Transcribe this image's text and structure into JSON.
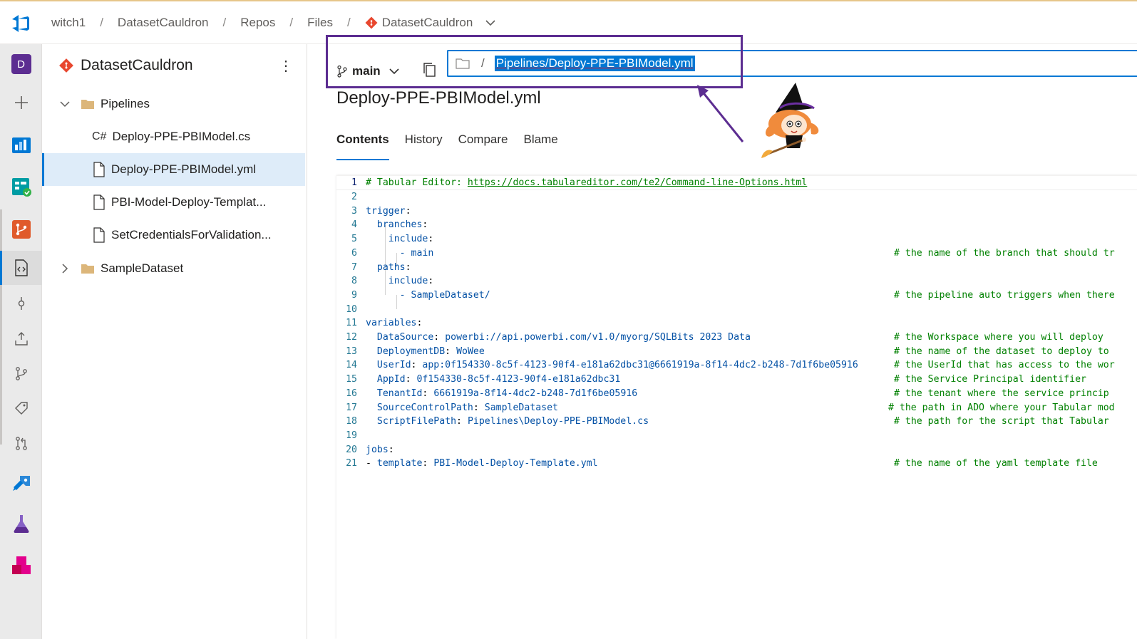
{
  "breadcrumb": {
    "org": "witch1",
    "project": "DatasetCauldron",
    "section": "Repos",
    "page": "Files",
    "repo": "DatasetCauldron"
  },
  "rail": {
    "avatar_letter": "D"
  },
  "tree": {
    "repo_name": "DatasetCauldron",
    "folder_pipelines": "Pipelines",
    "file_cs_tag": "C#",
    "file_cs": "Deploy-PPE-PBIModel.cs",
    "file_yml": "Deploy-PPE-PBIModel.yml",
    "file_template": "PBI-Model-Deploy-Templat...",
    "file_credentials": "SetCredentialsForValidation...",
    "folder_dataset": "SampleDataset"
  },
  "toolbar": {
    "branch": "main",
    "path_sep": "/",
    "path": "Pipelines/Deploy-PPE-PBIModel.yml"
  },
  "file": {
    "title": "Deploy-PPE-PBIModel.yml"
  },
  "tabs": [
    "Contents",
    "History",
    "Compare",
    "Blame"
  ],
  "code": {
    "l1_comment": "# Tabular Editor: ",
    "l1_link": "https://docs.tabulareditor.com/te2/Command-line-Options.html",
    "l3": "trigger",
    "l4": "branches",
    "l5": "include",
    "l6_val": "- main",
    "l6_comment": "# the name of the branch that should tr",
    "l7": "paths",
    "l8": "include",
    "l9_val": "- SampleDataset/",
    "l9_comment": "# the pipeline auto triggers when there",
    "l11": "variables",
    "l12_key": "DataSource",
    "l12_val": "powerbi://api.powerbi.com/v1.0/myorg/SQLBits 2023 Data",
    "l12_comment": "# the Workspace where you will deploy",
    "l13_key": "DeploymentDB",
    "l13_val": "WoWee",
    "l13_comment": "# the name of the dataset to deploy to",
    "l14_key": "UserId",
    "l14_val": "app:0f154330-8c5f-4123-90f4-e181a62dbc31@6661919a-8f14-4dc2-b248-7d1f6be05916",
    "l14_comment": "# the UserId that has access to the wor",
    "l15_key": "AppId",
    "l15_val": "0f154330-8c5f-4123-90f4-e181a62dbc31",
    "l15_comment": "# the Service Principal identifier",
    "l16_key": "TenantId",
    "l16_val": "6661919a-8f14-4dc2-b248-7d1f6be05916",
    "l16_comment": "# the tenant where the service princip",
    "l17_key": "SourceControlPath",
    "l17_val": "SampleDataset",
    "l17_comment": "# the path in ADO where your Tabular mod",
    "l18_key": "ScriptFilePath",
    "l18_val": "Pipelines\\Deploy-PPE-PBIModel.cs",
    "l18_comment": "# the path for the script that Tabular",
    "l20": "jobs",
    "l21_dash": "- ",
    "l21_key": "template",
    "l21_val": "PBI-Model-Deploy-Template.yml",
    "l21_comment": "# the name of the yaml template file"
  }
}
